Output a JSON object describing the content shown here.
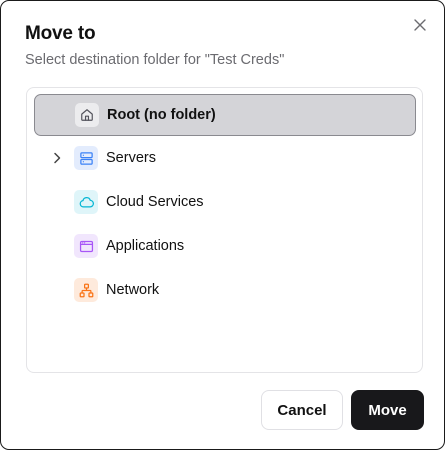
{
  "dialog": {
    "title": "Move to",
    "subtitle": "Select destination folder for \"Test Creds\"",
    "close_icon": "close-icon"
  },
  "folders": [
    {
      "label": "Root (no folder)",
      "icon": "home-icon",
      "selected": true,
      "expandable": false,
      "icon_color": "#52525b",
      "icon_bg": "#ececee"
    },
    {
      "label": "Servers",
      "icon": "server-icon",
      "selected": false,
      "expandable": true,
      "icon_color": "#3b82f6",
      "icon_bg": "#e3ecfd"
    },
    {
      "label": "Cloud Services",
      "icon": "cloud-icon",
      "selected": false,
      "expandable": false,
      "icon_color": "#06b6d4",
      "icon_bg": "#dff5f9"
    },
    {
      "label": "Applications",
      "icon": "app-window-icon",
      "selected": false,
      "expandable": false,
      "icon_color": "#a855f7",
      "icon_bg": "#f1e6fd"
    },
    {
      "label": "Network",
      "icon": "network-icon",
      "selected": false,
      "expandable": false,
      "icon_color": "#f97316",
      "icon_bg": "#feeadc"
    }
  ],
  "footer": {
    "cancel_label": "Cancel",
    "move_label": "Move"
  }
}
